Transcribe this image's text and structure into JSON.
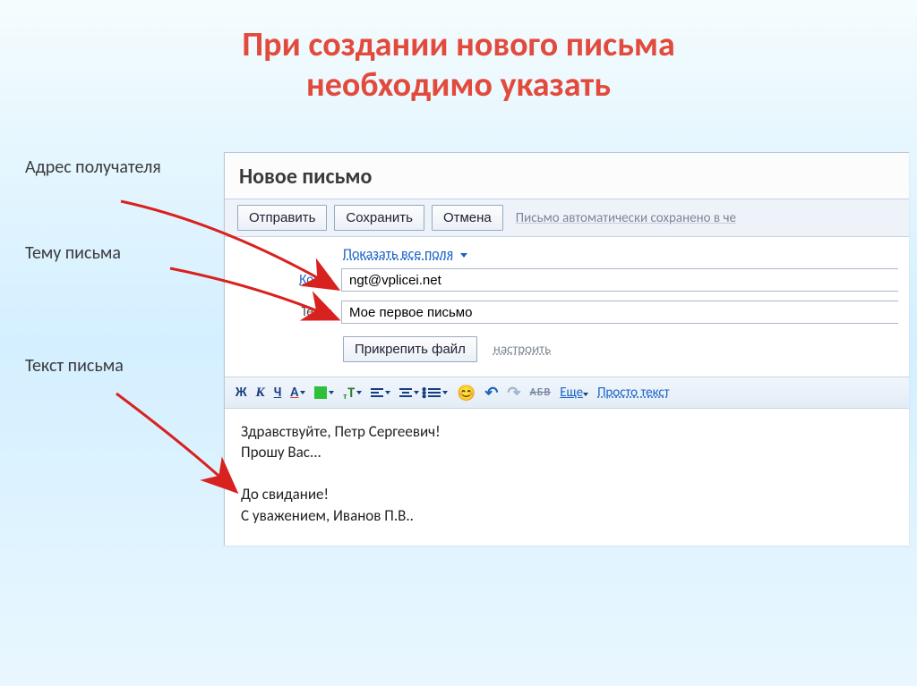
{
  "title_line1": "При создании нового письма",
  "title_line2": "необходимо указать",
  "callouts": {
    "recipient": "Адрес получателя",
    "subject": "Тему письма",
    "body": "Текст письма"
  },
  "client": {
    "heading": "Новое письмо",
    "toolbar": {
      "send": "Отправить",
      "save": "Сохранить",
      "cancel": "Отмена",
      "autosave": "Письмо автоматически сохранено в че"
    },
    "show_all_fields": "Показать все поля",
    "to_label": "Кому:",
    "to_value": "ngt@vplicei.net",
    "subject_label": "Тема:",
    "subject_value": "Мое первое письмо",
    "attach": "Прикрепить файл",
    "configure": "настроить",
    "format": {
      "bold": "Ж",
      "italic": "К",
      "underline": "Ч",
      "color": "А",
      "more": "Еще",
      "plain": "Просто текст",
      "abv": "АБВ"
    },
    "body_text": "Здравствуйте, Петр Сергеевич!\nПрошу Вас...\n\nДо свидание!\nС уважением, Иванов П.В.."
  }
}
